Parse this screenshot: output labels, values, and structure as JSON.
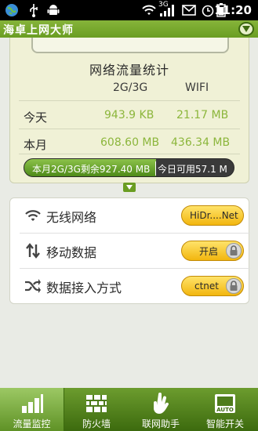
{
  "status_bar": {
    "time": "11:20",
    "network_label": "3G",
    "icons": [
      "globe-icon",
      "usb-icon",
      "android-icon",
      "wifi-icon",
      "signal-icon",
      "mail-icon",
      "alarm-icon",
      "battery-icon"
    ]
  },
  "app": {
    "title": "海卓上网大师"
  },
  "stats": {
    "title": "网络流量统计",
    "col_mobile": "2G/3G",
    "col_wifi": "WIFI",
    "rows": [
      {
        "label": "今天",
        "mobile": "943.9 KB",
        "wifi": "21.17 MB"
      },
      {
        "label": "本月",
        "mobile": "608.60 MB",
        "wifi": "436.34 MB"
      }
    ],
    "quota_left": "本月2G/3G剩余927.40 MB",
    "quota_right": "今日可用57.1 M",
    "quota_fill_fraction": 0.63
  },
  "settings": [
    {
      "label": "无线网络",
      "value": "HiDr....Net",
      "icon": "wifi-icon"
    },
    {
      "label": "移动数据",
      "value": "开启",
      "icon": "data-arrows-icon"
    },
    {
      "label": "数据接入方式",
      "value": "ctnet",
      "icon": "shuffle-icon"
    }
  ],
  "nav": [
    {
      "label": "流量监控",
      "icon": "bar-chart-icon",
      "active": true
    },
    {
      "label": "防火墙",
      "icon": "firewall-icon",
      "active": false
    },
    {
      "label": "联网助手",
      "icon": "hand-icon",
      "active": false
    },
    {
      "label": "智能开关",
      "icon": "auto-switch-icon",
      "active": false
    }
  ],
  "colors": {
    "accent_green": "#6a9d22",
    "value_green": "#8cb63c",
    "pill_yellow": "#f2b60e"
  }
}
